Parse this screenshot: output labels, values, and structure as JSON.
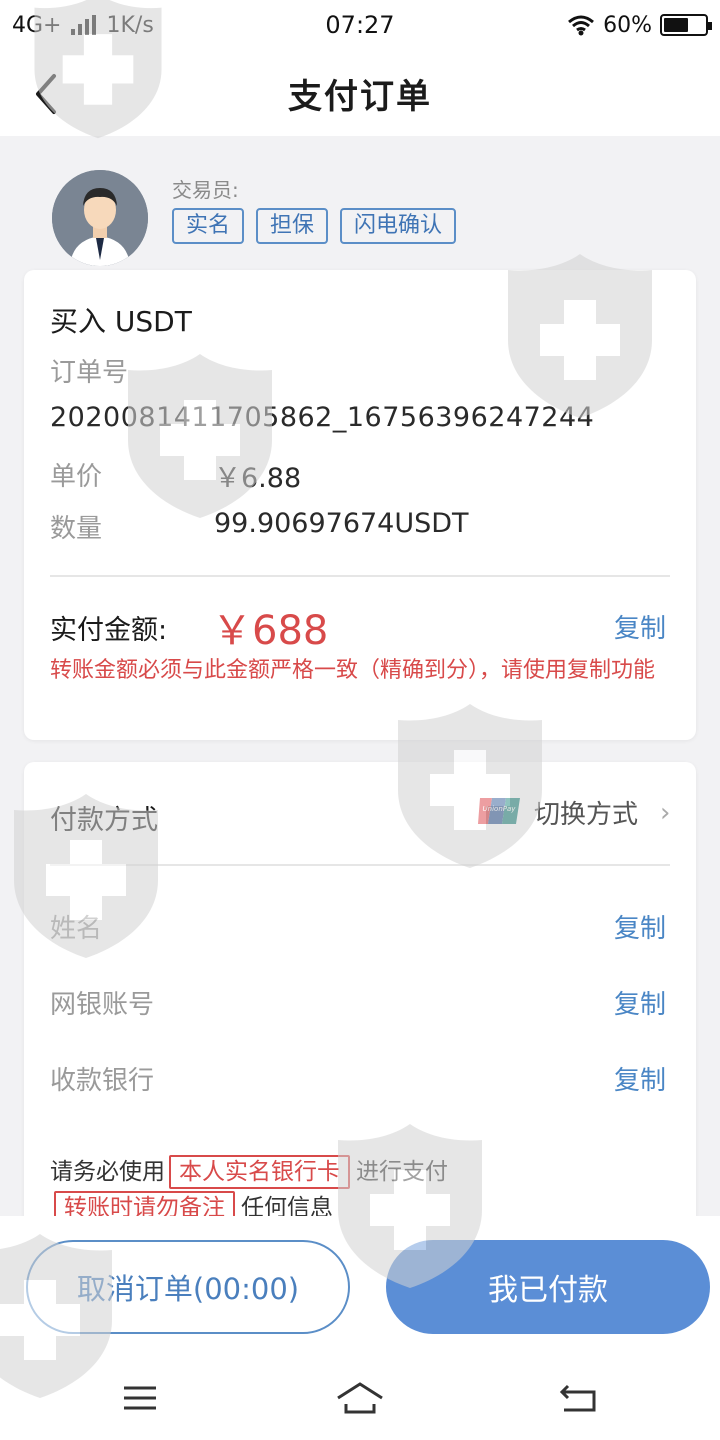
{
  "status_bar": {
    "network": "4G+",
    "speed": "1K/s",
    "time": "07:27",
    "battery": "60%",
    "battery_level": 0.6
  },
  "header": {
    "title": "支付订单",
    "back_icon": "chevron-left-icon"
  },
  "trader": {
    "label": "交易员:",
    "avatar_icon": "user-avatar-icon",
    "tags": [
      "实名",
      "担保",
      "闪电确认"
    ]
  },
  "order": {
    "type": "买入 USDT",
    "order_no_label": "订单号",
    "order_no": "2020081411705862_16756396247244",
    "price_label": "单价",
    "price": "￥6.88",
    "quantity_label": "数量",
    "quantity": "99.90697674USDT",
    "amount_label": "实付金额:",
    "amount": "￥688",
    "copy_label": "复制",
    "warning": "转账金额必须与此金额严格一致（精确到分），请使用复制功能"
  },
  "payment": {
    "method_label": "付款方式",
    "method_icon": "unionpay-icon",
    "switch_label": "切换方式",
    "fields": [
      {
        "label": "姓名",
        "copy": "复制"
      },
      {
        "label": "网银账号",
        "copy": "复制"
      },
      {
        "label": "收款银行",
        "copy": "复制"
      }
    ],
    "notice": {
      "part1": "请务必使用",
      "chip1": "本人实名银行卡",
      "part2": "进行支付",
      "chip2": "转账时请勿备注",
      "part3": "任何信息"
    }
  },
  "actions": {
    "cancel_label": "取消订单(00:00)",
    "paid_label": "我已付款"
  },
  "nav": {
    "icons": [
      "menu-icon",
      "home-icon",
      "back-icon"
    ]
  },
  "colors": {
    "accent": "#5b8ed6",
    "link": "#4a86c5",
    "warning": "#d84a4a",
    "watermark": "#d3d3d3"
  }
}
